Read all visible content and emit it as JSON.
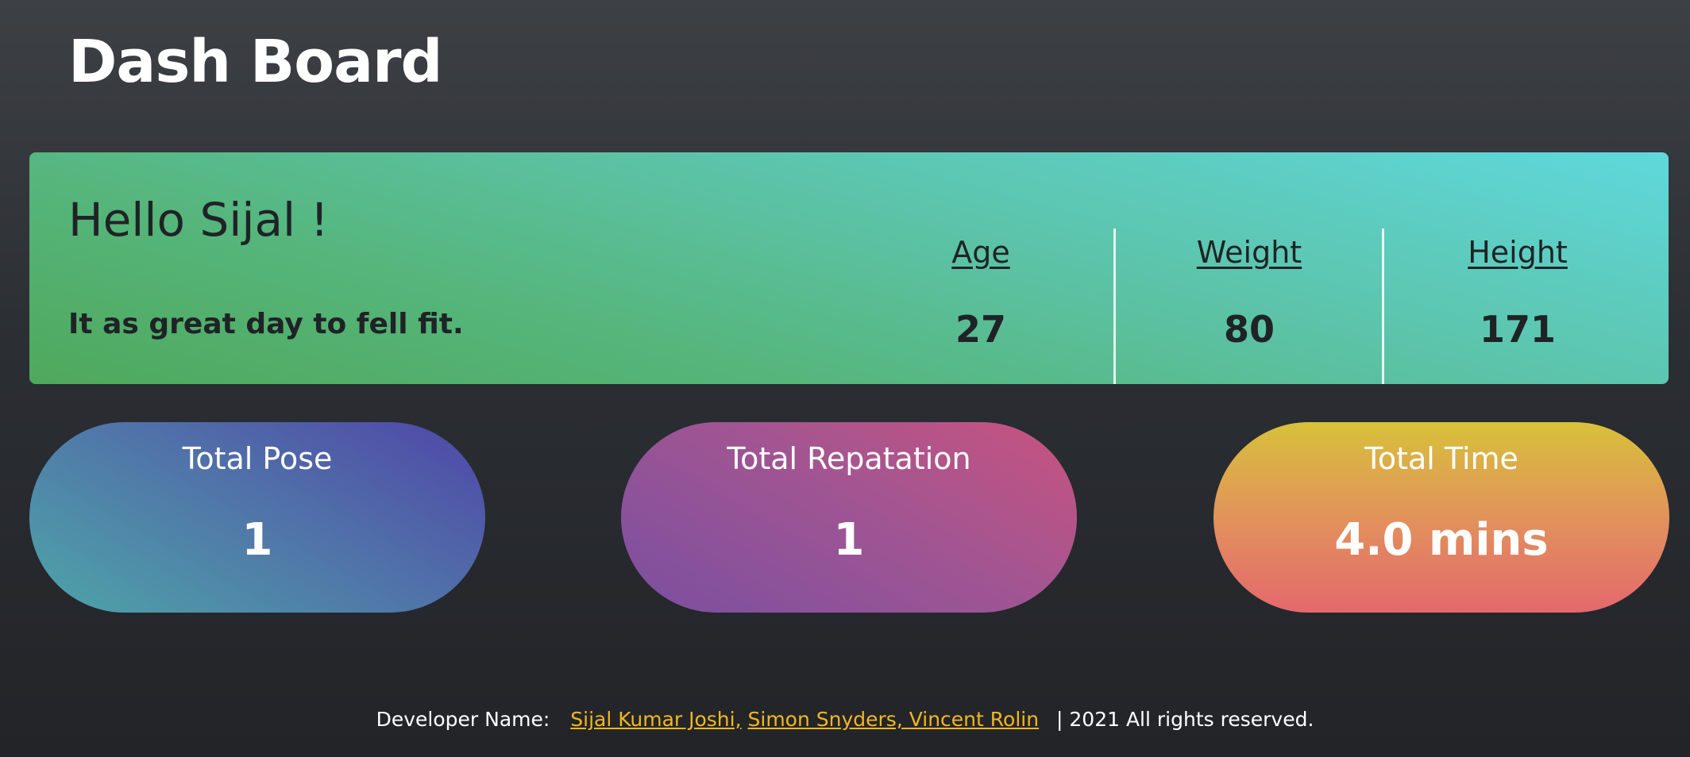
{
  "header": {
    "title": "Dash Board"
  },
  "profile": {
    "greeting": "Hello Sijal !",
    "motto": "It as great day to fell fit.",
    "stats": [
      {
        "label": "Age",
        "value": "27"
      },
      {
        "label": "Weight",
        "value": "80"
      },
      {
        "label": "Height",
        "value": "171"
      }
    ]
  },
  "metrics": [
    {
      "label": "Total Pose",
      "value": "1"
    },
    {
      "label": "Total Repatation",
      "value": "1"
    },
    {
      "label": "Total Time",
      "value": "4.0 mins"
    }
  ],
  "footer": {
    "developer_label": "Developer Name:",
    "developer_link_1": "Sijal Kumar Joshi,",
    "developer_link_2": "Simon Snyders, Vincent Rolin",
    "rights": "| 2021 All rights reserved."
  },
  "colors": {
    "background": "#2b2e33",
    "profile_card": "#5cc3a8",
    "pose_pill": "#5071a9",
    "repetition_pill": "#a15592",
    "time_pill": "#e28e5e",
    "link": "#f3b71f"
  }
}
